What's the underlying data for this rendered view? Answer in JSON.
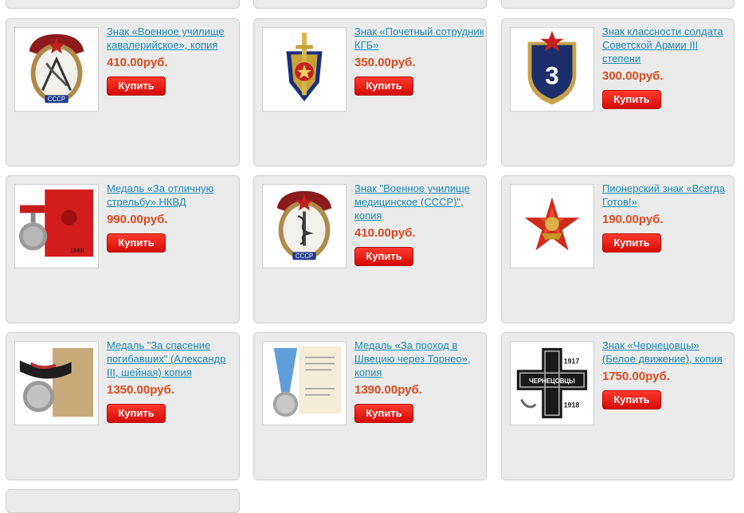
{
  "products": [
    {
      "title": "Знак «Военное училище кавалерийское», копия",
      "price": "410.00руб.",
      "buy_label": "Купить"
    },
    {
      "title": "Знак «Почетный сотрудник КГБ»",
      "price": "350.00руб.",
      "buy_label": "Купить"
    },
    {
      "title": "Знак классности солдата Советской Армии III степени",
      "price": "300.00руб.",
      "buy_label": "Купить"
    },
    {
      "title": "Медаль «За отличную стрельбу» НКВД",
      "price": "990.00руб.",
      "buy_label": "Купить"
    },
    {
      "title": "Знак \"Военное училище медицинское (СССР)\", копия",
      "price": "410.00руб.",
      "buy_label": "Купить"
    },
    {
      "title": "Пионерский знак «Всегда Готов!»",
      "price": "190.00руб.",
      "buy_label": "Купить"
    },
    {
      "title": "Медаль \"За спасение погибавших\" (Александр III, шейная) копия",
      "price": "1350.00руб.",
      "buy_label": "Купить"
    },
    {
      "title": "Медаль «За проход в Швецию через Торнео», копия",
      "price": "1390.00руб.",
      "buy_label": "Купить"
    },
    {
      "title": "Знак «Чернецовцы» (Белое движение), копия",
      "price": "1750.00руб.",
      "buy_label": "Купить"
    }
  ],
  "image_text": {
    "cccp": "СССР",
    "three": "3",
    "year": "1940г.",
    "chernetsovtsy": "ЧЕРНЕЦОВЦЫ",
    "y1917": "1917",
    "y1918": "1918"
  }
}
